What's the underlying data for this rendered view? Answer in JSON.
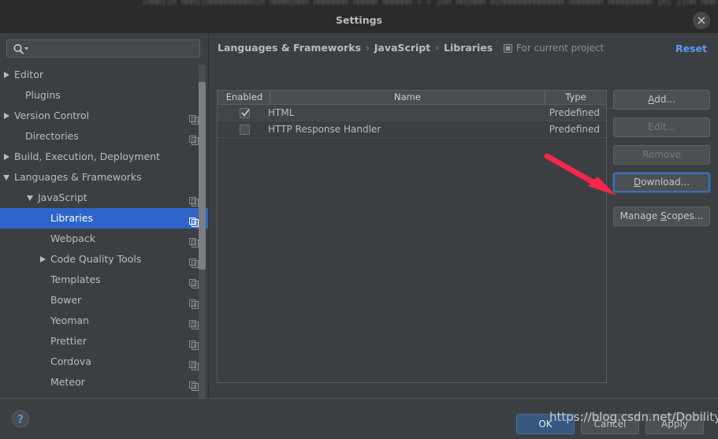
{
  "window": {
    "title": "Settings",
    "close_icon": "close-icon",
    "background_blur_text": "IHHHIIH HHHIIHHHHHHHHHHIH HHHHIHHH HHHHHHH HHHHH HHHHHH + +  IHH HHIHHH HIHHHHHHHHHHHHH HHHHHHH HHHHHHHHH IHI IIHH HHH IHHHH I IHHHH"
  },
  "sidebar": {
    "search": {
      "value": "",
      "placeholder": "",
      "icon": "search-icon"
    },
    "items": [
      {
        "label": "Editor",
        "indent": 18,
        "arrow": "collapsed",
        "selected": false,
        "copy_icon": false
      },
      {
        "label": "Plugins",
        "indent": 32,
        "arrow": "none",
        "selected": false,
        "copy_icon": false
      },
      {
        "label": "Version Control",
        "indent": 18,
        "arrow": "collapsed",
        "selected": false,
        "copy_icon": true
      },
      {
        "label": "Directories",
        "indent": 32,
        "arrow": "none",
        "selected": false,
        "copy_icon": true
      },
      {
        "label": "Build, Execution, Deployment",
        "indent": 18,
        "arrow": "collapsed",
        "selected": false,
        "copy_icon": false
      },
      {
        "label": "Languages & Frameworks",
        "indent": 18,
        "arrow": "expanded",
        "selected": false,
        "copy_icon": false
      },
      {
        "label": "JavaScript",
        "indent": 48,
        "arrow": "expanded",
        "selected": false,
        "copy_icon": true
      },
      {
        "label": "Libraries",
        "indent": 64,
        "arrow": "none",
        "selected": true,
        "copy_icon": true
      },
      {
        "label": "Webpack",
        "indent": 64,
        "arrow": "none",
        "selected": false,
        "copy_icon": true
      },
      {
        "label": "Code Quality Tools",
        "indent": 64,
        "arrow": "collapsed",
        "selected": false,
        "copy_icon": true
      },
      {
        "label": "Templates",
        "indent": 64,
        "arrow": "none",
        "selected": false,
        "copy_icon": true
      },
      {
        "label": "Bower",
        "indent": 64,
        "arrow": "none",
        "selected": false,
        "copy_icon": true
      },
      {
        "label": "Yeoman",
        "indent": 64,
        "arrow": "none",
        "selected": false,
        "copy_icon": true
      },
      {
        "label": "Prettier",
        "indent": 64,
        "arrow": "none",
        "selected": false,
        "copy_icon": true
      },
      {
        "label": "Cordova",
        "indent": 64,
        "arrow": "none",
        "selected": false,
        "copy_icon": true
      },
      {
        "label": "Meteor",
        "indent": 64,
        "arrow": "none",
        "selected": false,
        "copy_icon": true
      }
    ]
  },
  "content": {
    "breadcrumb": [
      "Languages & Frameworks",
      "JavaScript",
      "Libraries"
    ],
    "breadcrumb_separator": "›",
    "scope_note": "For current project",
    "scope_note_icon": "project-scope-icon",
    "reset_label": "Reset",
    "group_label": "Libraries",
    "table": {
      "columns": [
        "Enabled",
        "Name",
        "Type"
      ],
      "rows": [
        {
          "enabled": true,
          "name": "HTML",
          "type": "Predefined"
        },
        {
          "enabled": false,
          "name": "HTTP Response Handler",
          "type": "Predefined"
        }
      ]
    },
    "side_buttons": [
      {
        "label": "Add...",
        "mnemonic": "A",
        "state": "enabled",
        "focused": false
      },
      {
        "label": "Edit...",
        "mnemonic": "",
        "state": "disabled",
        "focused": false
      },
      {
        "label": "Remove",
        "mnemonic": "",
        "state": "disabled",
        "focused": false
      },
      {
        "label": "Download...",
        "mnemonic": "D",
        "state": "enabled",
        "focused": true
      },
      {
        "label": "Manage Scopes...",
        "mnemonic": "S",
        "state": "enabled",
        "focused": false
      }
    ]
  },
  "footer": {
    "help_icon": "help-icon",
    "ok_label": "OK",
    "cancel_label": "Cancel",
    "apply_label": "Apply"
  },
  "annotations": {
    "arrow_color": "#f5264a",
    "arrow_target": "download-button",
    "watermark": "https://blog.csdn.net/Dobility"
  },
  "colors": {
    "accent_selection": "#2f65ca",
    "link": "#589df6",
    "primary_button": "#365880",
    "panel_bg": "#3c3f41",
    "titlebar_bg": "#2b2b2b"
  }
}
